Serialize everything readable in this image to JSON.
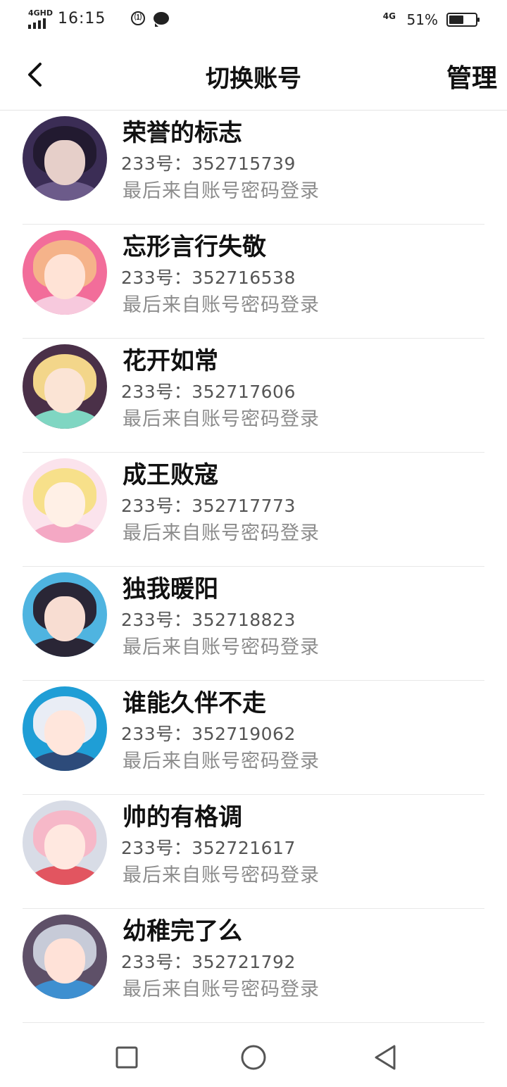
{
  "status_bar": {
    "network": "4GHD",
    "time": "16:15",
    "notify_badge": "⑴",
    "mobile_data": "4G",
    "battery": "51%",
    "battery_level": 0.51
  },
  "header": {
    "title": "切换账号",
    "manage_label": "管理"
  },
  "accounts": [
    {
      "name": "荣誉的标志",
      "uid": "233号：352715739",
      "note": "最后来自账号密码登录",
      "colors": {
        "bg": "#3b2d55",
        "hair": "#221a30",
        "face": "#e6cfc9",
        "body": "#6c5b8a"
      }
    },
    {
      "name": "忘形言行失敬",
      "uid": "233号：352716538",
      "note": "最后来自账号密码登录",
      "colors": {
        "bg": "#f26d9a",
        "hair": "#f5b38a",
        "face": "#ffe3d6",
        "body": "#f7c9dd"
      }
    },
    {
      "name": "花开如常",
      "uid": "233号：352717606",
      "note": "最后来自账号密码登录",
      "colors": {
        "bg": "#4a3048",
        "hair": "#f3d68a",
        "face": "#fbe4d5",
        "body": "#7fd6c2"
      }
    },
    {
      "name": "成王败寇",
      "uid": "233号：352717773",
      "note": "最后来自账号密码登录",
      "colors": {
        "bg": "#fbe3ec",
        "hair": "#f7e08a",
        "face": "#fff0e6",
        "body": "#f4a8c4"
      }
    },
    {
      "name": "独我暖阳",
      "uid": "233号：352718823",
      "note": "最后来自账号密码登录",
      "colors": {
        "bg": "#4fb4e0",
        "hair": "#2a2636",
        "face": "#f8ddd2",
        "body": "#2a2636"
      }
    },
    {
      "name": "谁能久伴不走",
      "uid": "233号：352719062",
      "note": "最后来自账号密码登录",
      "colors": {
        "bg": "#1f9ed6",
        "hair": "#e9edf5",
        "face": "#ffe6dc",
        "body": "#2d4b7a"
      }
    },
    {
      "name": "帅的有格调",
      "uid": "233号：352721617",
      "note": "最后来自账号密码登录",
      "colors": {
        "bg": "#d8dce6",
        "hair": "#f6b8c8",
        "face": "#ffe8e0",
        "body": "#e25560"
      }
    },
    {
      "name": "幼稚完了么",
      "uid": "233号：352721792",
      "note": "最后来自账号密码登录",
      "colors": {
        "bg": "#5e5068",
        "hair": "#c7cbd8",
        "face": "#ffe2d8",
        "body": "#3e8fd0"
      }
    }
  ]
}
